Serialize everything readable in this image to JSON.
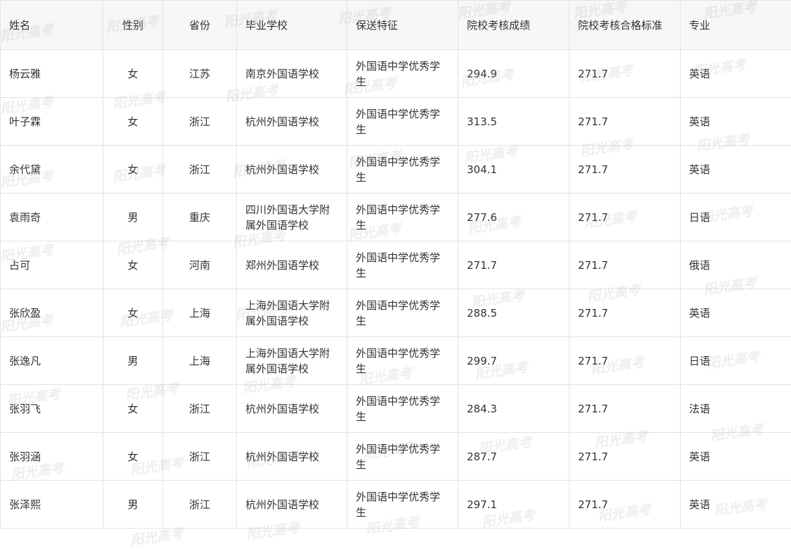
{
  "watermark_text": "阳光高考",
  "table": {
    "headers": [
      "姓名",
      "性别",
      "省份",
      "毕业学校",
      "保送特征",
      "院校考核成绩",
      "院校考核合格标准",
      "专业"
    ],
    "rows": [
      [
        "杨云雅",
        "女",
        "江苏",
        "南京外国语学校",
        "外国语中学优秀学生",
        "294.9",
        "271.7",
        "英语"
      ],
      [
        "叶子霖",
        "女",
        "浙江",
        "杭州外国语学校",
        "外国语中学优秀学生",
        "313.5",
        "271.7",
        "英语"
      ],
      [
        "余代黛",
        "女",
        "浙江",
        "杭州外国语学校",
        "外国语中学优秀学生",
        "304.1",
        "271.7",
        "英语"
      ],
      [
        "袁雨奇",
        "男",
        "重庆",
        "四川外国语大学附属外国语学校",
        "外国语中学优秀学生",
        "277.6",
        "271.7",
        "日语"
      ],
      [
        "占可",
        "女",
        "河南",
        "郑州外国语学校",
        "外国语中学优秀学生",
        "271.7",
        "271.7",
        "俄语"
      ],
      [
        "张欣盈",
        "女",
        "上海",
        "上海外国语大学附属外国语学校",
        "外国语中学优秀学生",
        "288.5",
        "271.7",
        "英语"
      ],
      [
        "张逸凡",
        "男",
        "上海",
        "上海外国语大学附属外国语学校",
        "外国语中学优秀学生",
        "299.7",
        "271.7",
        "日语"
      ],
      [
        "张羽飞",
        "女",
        "浙江",
        "杭州外国语学校",
        "外国语中学优秀学生",
        "284.3",
        "271.7",
        "法语"
      ],
      [
        "张羽涵",
        "女",
        "浙江",
        "杭州外国语学校",
        "外国语中学优秀学生",
        "287.7",
        "271.7",
        "英语"
      ],
      [
        "张泽熙",
        "男",
        "浙江",
        "杭州外国语学校",
        "外国语中学优秀学生",
        "297.1",
        "271.7",
        "英语"
      ]
    ]
  }
}
